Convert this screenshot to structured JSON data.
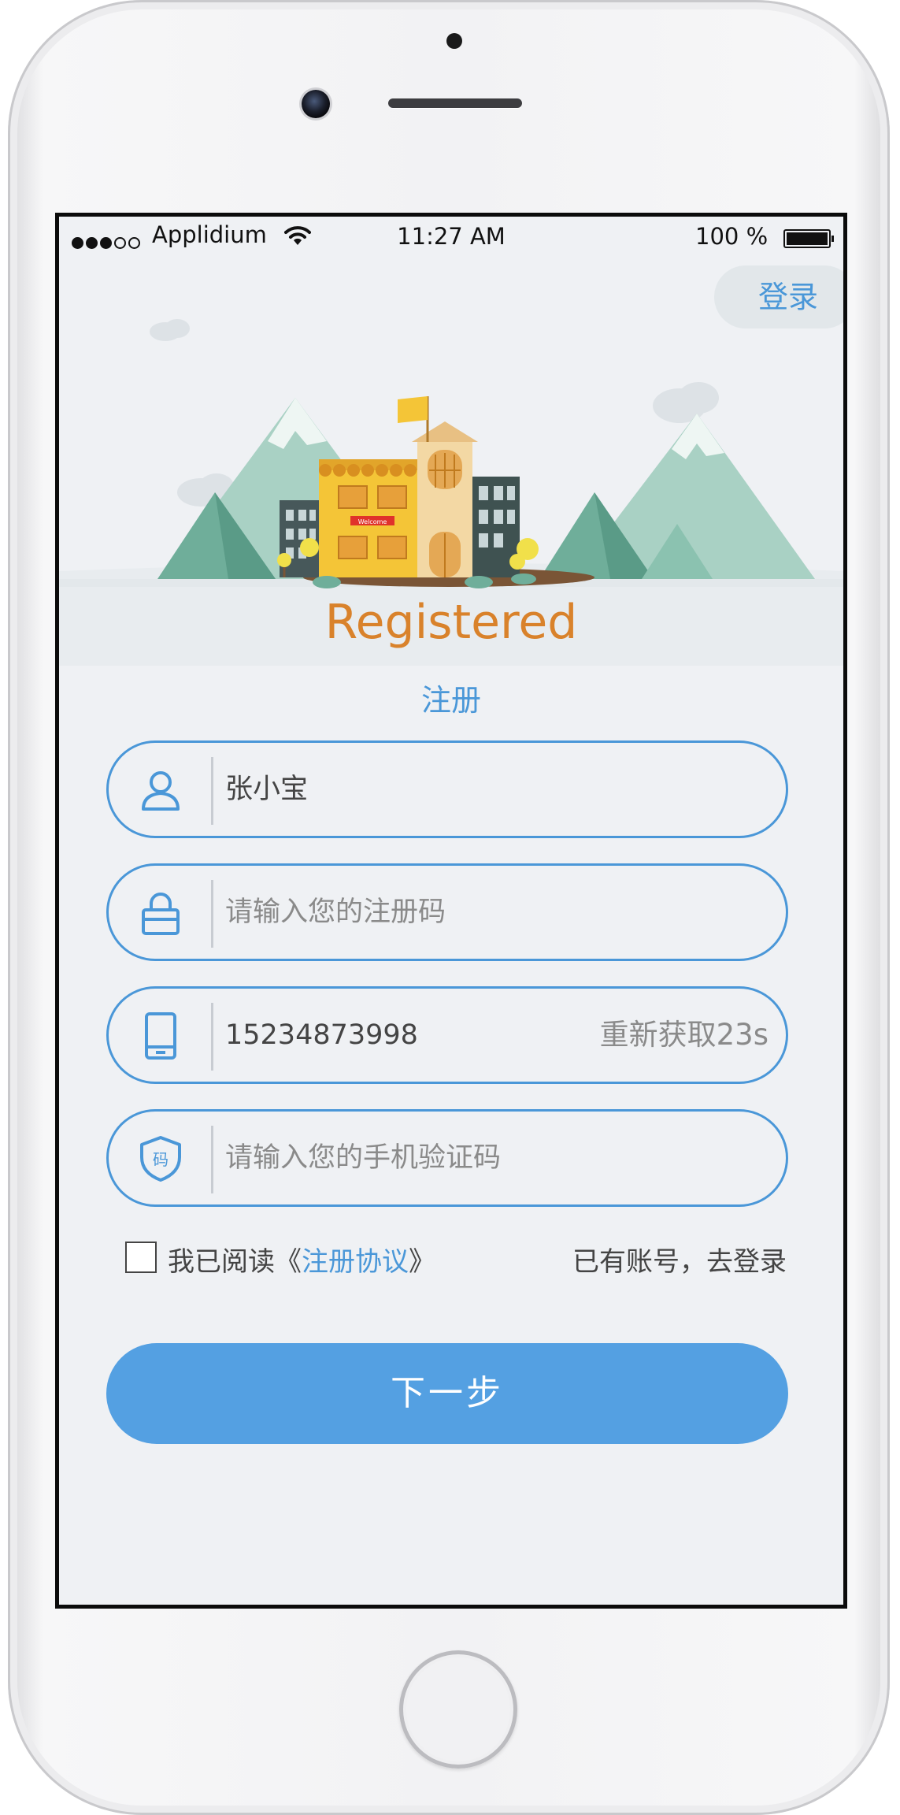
{
  "status_bar": {
    "carrier": "Applidium",
    "time": "11:27 AM",
    "battery": "100 %",
    "signal_icon": "signal-dots-icon",
    "wifi_icon": "wifi-icon",
    "battery_icon": "battery-icon"
  },
  "header": {
    "login_link": "登录",
    "illustration_icon": "school-buildings-mountains-illustration",
    "sign_text": "Welcome"
  },
  "title": {
    "english": "Registered",
    "chinese": "注册"
  },
  "form": {
    "username": {
      "icon": "user-icon",
      "value": "张小宝",
      "placeholder": ""
    },
    "registration_code": {
      "icon": "lock-icon",
      "value": "",
      "placeholder": "请输入您的注册码"
    },
    "phone": {
      "icon": "phone-icon",
      "value": "15234873998",
      "placeholder": "",
      "resend_label": "重新获取23s"
    },
    "verification_code": {
      "icon": "shield-code-icon",
      "icon_text": "码",
      "value": "",
      "placeholder": "请输入您的手机验证码"
    }
  },
  "agreement": {
    "checked": false,
    "prefix": "我已阅读《",
    "link": "注册协议",
    "suffix": "》",
    "have_account": "已有账号，去登录"
  },
  "next_button": "下一步",
  "colors": {
    "accent": "#4a97d8",
    "button": "#54a0e2",
    "title_orange": "#d9822b",
    "background": "#eff1f4"
  }
}
